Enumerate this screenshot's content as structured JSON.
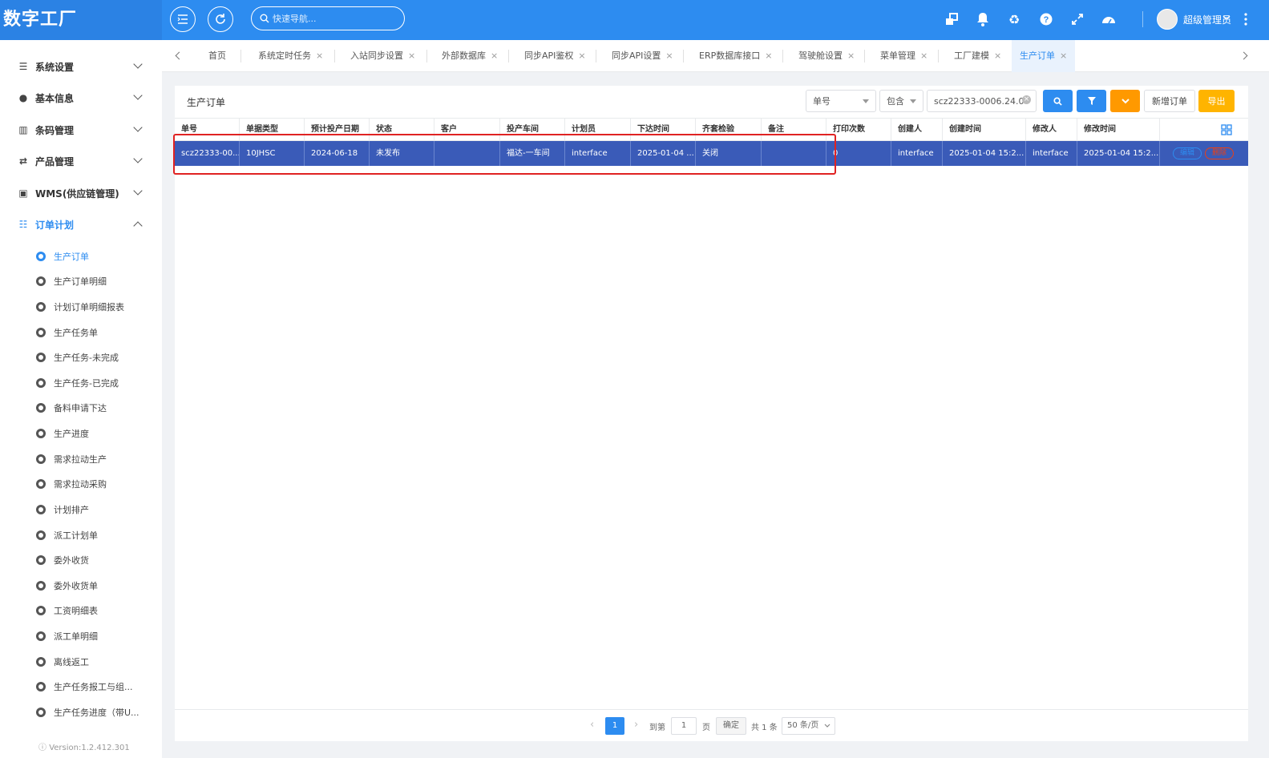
{
  "app": {
    "logo": "数字工厂"
  },
  "topbar": {
    "search_placeholder": "快速导航...",
    "user_name": "超级管理员"
  },
  "sidebar": {
    "groups": [
      {
        "label": "系统设置",
        "icon": "list-icon"
      },
      {
        "label": "基本信息",
        "icon": "compass-icon"
      },
      {
        "label": "条码管理",
        "icon": "barcode-icon"
      },
      {
        "label": "产品管理",
        "icon": "shuffle-icon"
      },
      {
        "label": "WMS(供应链管理)",
        "icon": "train-icon"
      },
      {
        "label": "订单计划",
        "icon": "sliders-icon"
      }
    ],
    "sub_items": [
      "生产订单",
      "生产订单明细",
      "计划订单明细报表",
      "生产任务单",
      "生产任务-未完成",
      "生产任务-已完成",
      "备料申请下达",
      "生产进度",
      "需求拉动生产",
      "需求拉动采购",
      "计划排产",
      "派工计划单",
      "委外收货",
      "委外收货单",
      "工资明细表",
      "派工单明细",
      "离线返工",
      "生产任务报工与组...",
      "生产任务进度（带U..."
    ],
    "version": "Version:1.2.412.301"
  },
  "tabs": [
    "首页",
    "系统定时任务",
    "入站同步设置",
    "外部数据库",
    "同步API鉴权",
    "同步API设置",
    "ERP数据库接口",
    "驾驶舱设置",
    "菜单管理",
    "工厂建模",
    "生产订单"
  ],
  "panel": {
    "title": "生产订单",
    "field_select": "单号",
    "op_select": "包含",
    "search_value": "scz22333-0006.24.0",
    "add_button": "新增订单",
    "export_button": "导出"
  },
  "table": {
    "columns": [
      "单号",
      "单据类型",
      "预计投产日期",
      "状态",
      "客户",
      "投产车间",
      "计划员",
      "下达时间",
      "齐套检验",
      "备注",
      "打印次数",
      "创建人",
      "创建时间",
      "修改人",
      "修改时间"
    ],
    "rows": [
      [
        "scz22333-00...",
        "10JHSC",
        "2024-06-18",
        "未发布",
        "",
        "福达-一车间",
        "interface",
        "2025-01-04 ...",
        "关闭",
        "",
        "0",
        "interface",
        "2025-01-04 15:2...",
        "interface",
        "2025-01-04 15:2..."
      ]
    ],
    "row_actions": [
      "编辑",
      "删除"
    ]
  },
  "pagination": {
    "current_page": "1",
    "goto_label": "到第",
    "goto_value": "1",
    "page_label": "页",
    "confirm": "确定",
    "total": "共 1 条",
    "page_size": "50 条/页"
  },
  "colors": {
    "primary": "#2d8cf0",
    "warning": "#ff9900",
    "selected_row": "#3a5bb8",
    "highlight": "#e02222"
  }
}
